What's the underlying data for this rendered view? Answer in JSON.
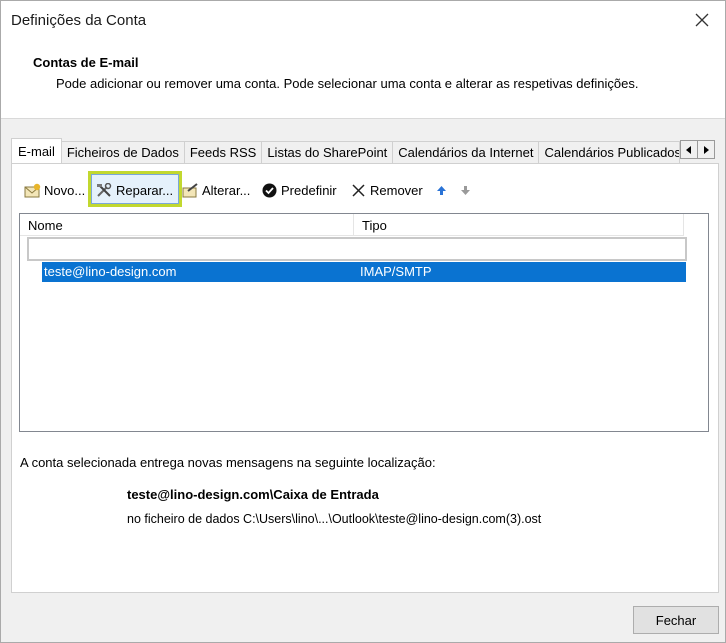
{
  "window": {
    "title": "Definições da Conta"
  },
  "header": {
    "section_title": "Contas de E-mail",
    "description": "Pode adicionar ou remover uma conta. Pode selecionar uma conta e alterar as respetivas definições."
  },
  "tabs": [
    {
      "label": "E-mail",
      "active": true
    },
    {
      "label": "Ficheiros de Dados"
    },
    {
      "label": "Feeds RSS"
    },
    {
      "label": "Listas do SharePoint"
    },
    {
      "label": "Calendários da Internet"
    },
    {
      "label": "Calendários Publicados"
    }
  ],
  "toolbar": {
    "new_label": "Novo...",
    "repair_label": "Reparar...",
    "change_label": "Alterar...",
    "default_label": "Predefinir",
    "remove_label": "Remover"
  },
  "list": {
    "col_name": "Nome",
    "col_type": "Tipo",
    "rows": [
      {
        "name": "teste@lino-design.com",
        "type": "IMAP/SMTP",
        "selected": true
      }
    ]
  },
  "location": {
    "label": "A conta selecionada entrega novas mensagens na seguinte localização:",
    "folder": "teste@lino-design.com\\Caixa de Entrada",
    "file": "no ficheiro de dados C:\\Users\\lino\\...\\Outlook\\teste@lino-design.com(3).ost"
  },
  "footer": {
    "close_label": "Fechar"
  },
  "colors": {
    "selection": "#0a73d1",
    "highlight": "#c2d82f"
  }
}
